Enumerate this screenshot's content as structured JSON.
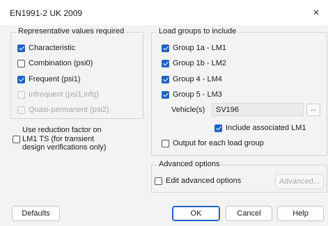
{
  "window": {
    "title": "EN1991-2 UK 2009",
    "close_glyph": "×"
  },
  "representative": {
    "label": "Representative values required",
    "items": [
      {
        "label": "Characteristic",
        "checked": true,
        "enabled": true
      },
      {
        "label": "Combination (psi0)",
        "checked": false,
        "enabled": true
      },
      {
        "label": "Frequent (psi1)",
        "checked": true,
        "enabled": true
      },
      {
        "label": "Infrequent (psi1,infq)",
        "checked": false,
        "enabled": false
      },
      {
        "label": "Quasi-permanent (psi2)",
        "checked": false,
        "enabled": false
      }
    ]
  },
  "reduction": {
    "label_line1": "Use reduction factor on",
    "label_line2": "LM1 TS (for transient",
    "label_line3": "design verifications only)",
    "checked": false
  },
  "load_groups": {
    "label": "Load groups to include",
    "items": [
      {
        "label": "Group 1a - LM1",
        "checked": true
      },
      {
        "label": "Group 1b - LM2",
        "checked": true
      },
      {
        "label": "Group 4 - LM4",
        "checked": true
      },
      {
        "label": "Group 5 - LM3",
        "checked": true
      }
    ],
    "vehicle_label": "Vehicle(s)",
    "vehicle_value": "SV196",
    "ellipsis": "...",
    "include_lm1": {
      "label": "Include associated LM1",
      "checked": true
    },
    "output_each": {
      "label": "Output for each load group",
      "checked": false
    }
  },
  "advanced": {
    "label": "Advanced options",
    "edit": {
      "label": "Edit advanced options",
      "checked": false
    },
    "button": "Advanced..."
  },
  "buttons": {
    "defaults": "Defaults",
    "ok": "OK",
    "cancel": "Cancel",
    "help": "Help"
  },
  "colors": {
    "accent": "#1f63c6",
    "background": "#f3f3f3"
  }
}
